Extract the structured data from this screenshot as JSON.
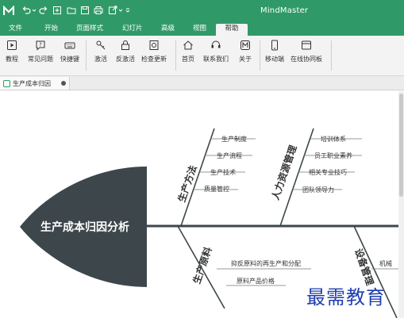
{
  "app": {
    "title": "MindMaster"
  },
  "tabs": [
    {
      "label": "文件"
    },
    {
      "label": "开始"
    },
    {
      "label": "页面样式"
    },
    {
      "label": "幻灯片"
    },
    {
      "label": "高级"
    },
    {
      "label": "视图"
    },
    {
      "label": "帮助",
      "active": true
    }
  ],
  "ribbon": [
    {
      "label": "教程",
      "icon": "play-icon"
    },
    {
      "label": "常见问题",
      "icon": "question-bubble-icon"
    },
    {
      "label": "快捷键",
      "icon": "keyboard-icon"
    },
    {
      "label": "激活",
      "icon": "key-icon"
    },
    {
      "label": "反激活",
      "icon": "lock-icon"
    },
    {
      "label": "检查更新",
      "icon": "update-icon"
    },
    {
      "label": "首页",
      "icon": "home-icon"
    },
    {
      "label": "联系我们",
      "icon": "headset-icon"
    },
    {
      "label": "关于",
      "icon": "logo-icon"
    },
    {
      "label": "移动端",
      "icon": "phone-icon"
    },
    {
      "label": "在线协同板",
      "icon": "window-icon"
    }
  ],
  "document_tab": {
    "label": "生产成本归因"
  },
  "diagram": {
    "head": "生产成本归因分析",
    "branches": [
      {
        "label": "生产方法",
        "subs": [
          "生产制度",
          "生产流程",
          "生产技术",
          "质量管控"
        ]
      },
      {
        "label": "人力资源管理",
        "subs": [
          "培训体系",
          "员工职业素养",
          "相关专业技巧",
          "团队领导力"
        ]
      },
      {
        "label": "生产原料",
        "subs": [
          "抑反原料的再生产和分配",
          "原料产品价格"
        ]
      },
      {
        "label": "设备管理",
        "subs": [
          "机械"
        ]
      }
    ]
  },
  "watermark": "最需教育",
  "colors": {
    "accent": "#2f9a68",
    "head": "#3d474b",
    "watermark": "#1f3fae"
  }
}
